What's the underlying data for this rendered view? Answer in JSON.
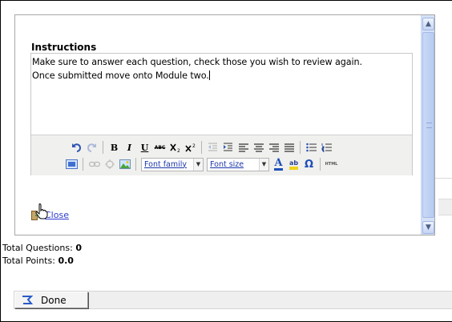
{
  "modal": {
    "instructions_label": "Instructions",
    "editor": {
      "lines": [
        "Make sure to answer each question, check those you wish to review again.",
        "Once submitted move onto Module two."
      ]
    },
    "toolbar": {
      "row1": [
        "undo",
        "redo",
        "bold",
        "italic",
        "underline",
        "strikethrough",
        "subscript",
        "superscript",
        "outdent",
        "indent",
        "align-left",
        "align-center",
        "align-right",
        "align-justify",
        "bullet-list",
        "numbered-list"
      ],
      "font_family": "Font family",
      "font_size": "Font size",
      "row2_icons": [
        "media",
        "link",
        "unlink",
        "image",
        "font-color",
        "highlight-color",
        "special-character",
        "html-source"
      ],
      "html_label": "HTML",
      "bold_glyph": "B",
      "italic_glyph": "I",
      "underline_glyph": "U",
      "strike_glyph": "ABC",
      "color_glyph": "A",
      "highlight_glyph": "ab",
      "omega_glyph": "Ω"
    },
    "close_label": "Close"
  },
  "totals": {
    "questions_label": "Total Questions:",
    "questions_value": "0",
    "points_label": "Total Points:",
    "points_value": "0.0"
  },
  "done_button": {
    "label": "Done"
  },
  "colors": {
    "link": "#2d3ccf",
    "scrollbar": "#d6e1f7",
    "toolbar_bg": "#f0f0ee"
  }
}
